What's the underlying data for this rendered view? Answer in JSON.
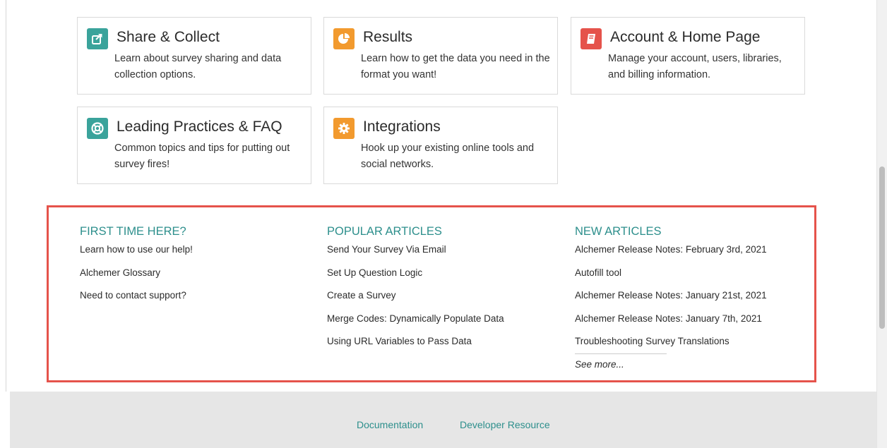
{
  "cards": [
    {
      "title": "Share & Collect",
      "description": "Learn about survey sharing and data collection options.",
      "icon": "share-icon",
      "color": "#3aa39b"
    },
    {
      "title": "Results",
      "description": " Learn how to get the data you need in the format you want!",
      "icon": "pie-chart-icon",
      "color": "#f29a2e"
    },
    {
      "title": "Account & Home Page",
      "description": "Manage your account, users, libraries, and billing information.",
      "icon": "book-icon",
      "color": "#e5534b"
    },
    {
      "title": "Leading Practices & FAQ",
      "description": " Common topics and tips for putting out survey fires!",
      "icon": "life-ring-icon",
      "color": "#3aa39b"
    },
    {
      "title": "Integrations",
      "description": "Hook up your existing online tools and social networks.",
      "icon": "gear-icon",
      "color": "#f29a2e"
    }
  ],
  "articles": {
    "first_time": {
      "heading": "FIRST TIME HERE?",
      "links": [
        "Learn how to use our help!",
        "Alchemer Glossary",
        "Need to contact support?"
      ]
    },
    "popular": {
      "heading": "POPULAR ARTICLES",
      "links": [
        "Send Your Survey Via Email",
        "Set Up Question Logic",
        "Create a Survey",
        "Merge Codes: Dynamically Populate Data",
        "Using URL Variables to Pass Data"
      ]
    },
    "new": {
      "heading": "NEW ARTICLES",
      "links": [
        "Alchemer Release Notes: February 3rd, 2021",
        "Autofill tool",
        "Alchemer Release Notes: January 21st, 2021",
        "Alchemer Release Notes: January 7th, 2021",
        "Troubleshooting Survey Translations"
      ],
      "see_more": "See more..."
    }
  },
  "footer": {
    "documentation": "Documentation",
    "developer_resource": "Developer Resource"
  },
  "colors": {
    "accent": "#2d8f8c",
    "highlight_border": "#e5534b"
  }
}
